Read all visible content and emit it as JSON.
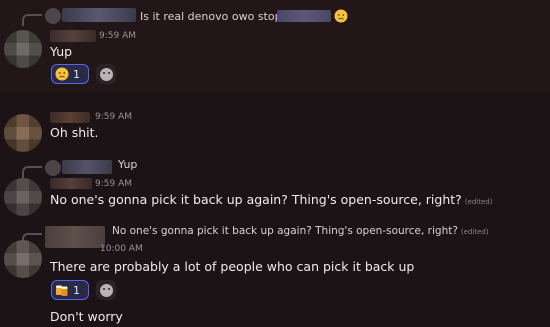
{
  "messages": [
    {
      "reply_preview": "Is it real denovo owo stopped",
      "reply_emoji": "sad-tear-face",
      "time": "9:59 AM",
      "text": "Yup",
      "reactions": [
        {
          "emoji": "sad-tear-face",
          "count": "1"
        }
      ]
    },
    {
      "time": "9:59 AM",
      "text": "Oh shit."
    },
    {
      "reply_preview": "Yup",
      "time": "9:59 AM",
      "text": "No one's gonna pick it back up again? Thing's open-source, right?",
      "edited": "(edited)"
    },
    {
      "reply_preview": "No one's gonna pick it back up again? Thing's open-source, right?",
      "reply_edited": "(edited)",
      "time": "10:00 AM",
      "text": "There are probably a lot of people who can pick it back up",
      "reactions": [
        {
          "emoji": "beers",
          "count": "1"
        }
      ]
    },
    {
      "text": "Don't worry"
    }
  ],
  "colors": {
    "background": "#1c1316",
    "reaction_border": "#5865f2",
    "reaction_bg": "#2a2a44"
  },
  "icons": {
    "add_reaction": "smile-plus-icon"
  }
}
